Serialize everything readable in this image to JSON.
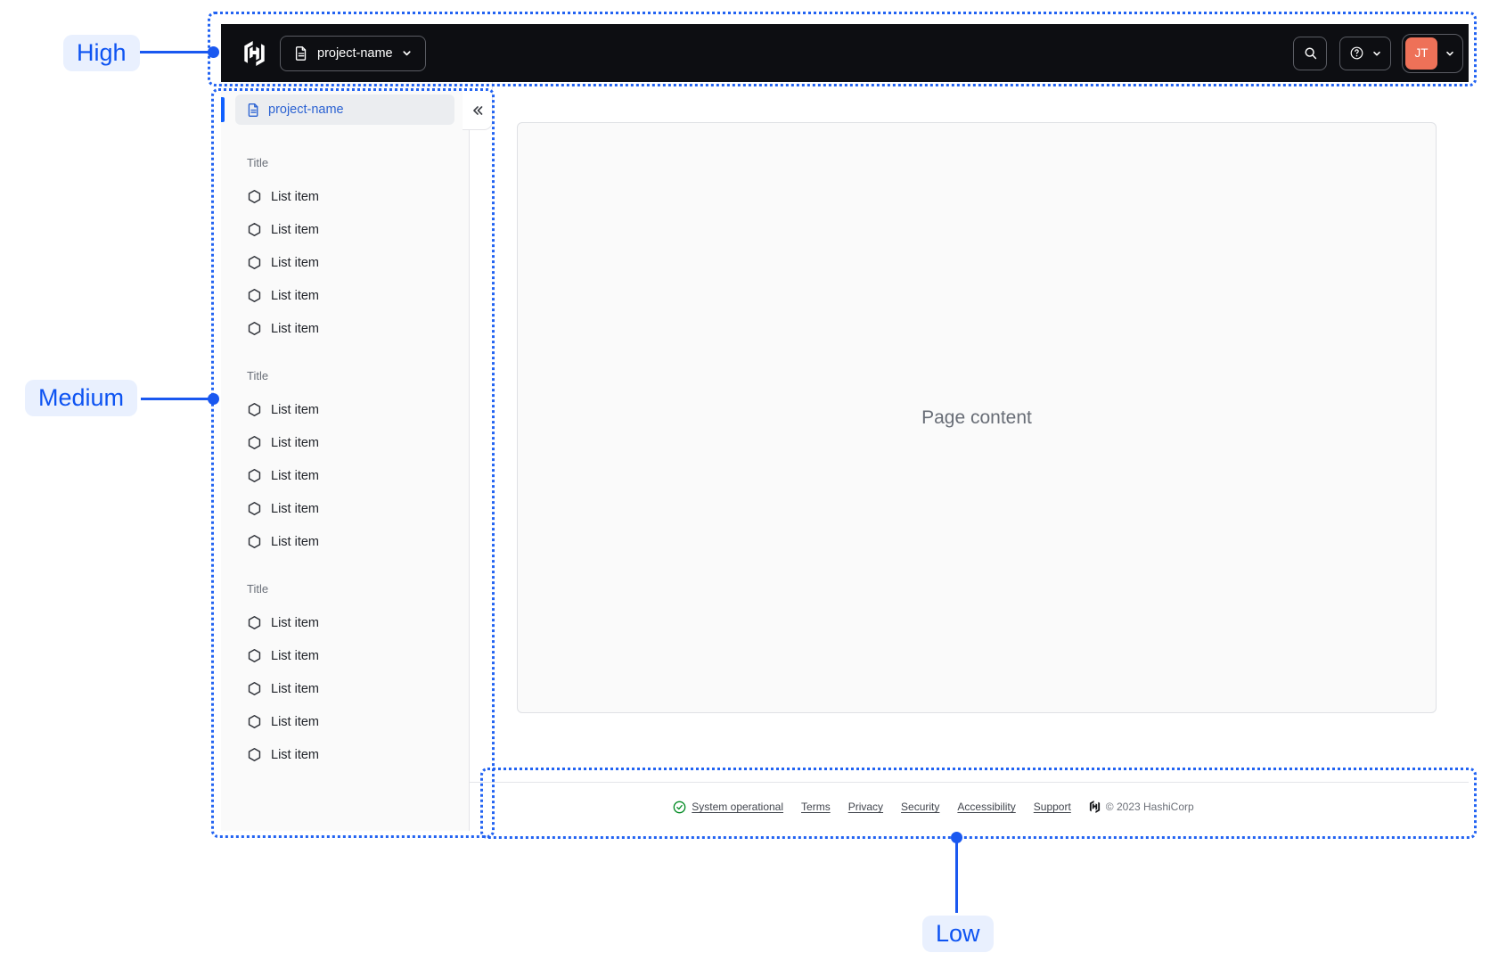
{
  "annotations": {
    "high": "High",
    "medium": "Medium",
    "low": "Low"
  },
  "navbar": {
    "project_switcher_label": "project-name"
  },
  "user_menu": {
    "initials": "JT"
  },
  "sidebar": {
    "active_item": "project-name",
    "sections": [
      {
        "title": "Title",
        "items": [
          "List item",
          "List item",
          "List item",
          "List item",
          "List item"
        ]
      },
      {
        "title": "Title",
        "items": [
          "List item",
          "List item",
          "List item",
          "List item",
          "List item"
        ]
      },
      {
        "title": "Title",
        "items": [
          "List item",
          "List item",
          "List item",
          "List item",
          "List item"
        ]
      }
    ]
  },
  "content": {
    "placeholder": "Page content"
  },
  "footer": {
    "status_label": "System operational",
    "links": [
      "Terms",
      "Privacy",
      "Security",
      "Accessibility",
      "Support"
    ],
    "copyright": "© 2023 HashiCorp"
  },
  "icons": {
    "brand": "hashicorp-logo",
    "project": "file-text-icon",
    "search": "search-icon",
    "help": "help-icon",
    "dropdown": "chevron-down-icon",
    "collapse": "double-chevron-left-icon",
    "list_item": "hexagon-icon",
    "status": "check-circle-icon"
  },
  "colors": {
    "annotation_blue": "#1a58f0",
    "annotation_pill_bg": "#e9f0fe",
    "navbar_bg": "#0d0e12",
    "avatar_bg": "#ee7158",
    "status_green": "#008a22",
    "active_link_blue": "#2b62d2",
    "accent_bar_blue": "#1060ff",
    "panel_bg": "#fafafa"
  }
}
